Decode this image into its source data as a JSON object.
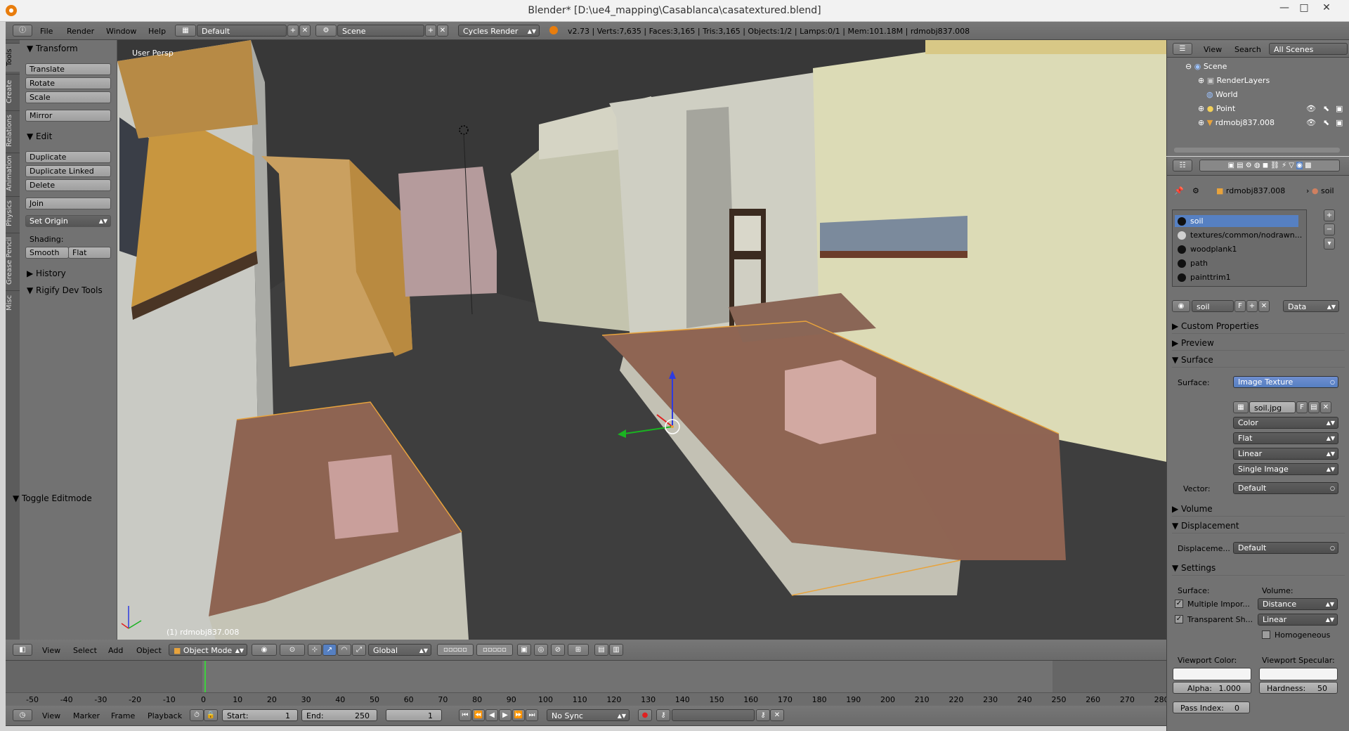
{
  "window": {
    "title": "Blender* [D:\\ue4_mapping\\Casablanca\\casatextured.blend]",
    "minimize": "—",
    "maximize": "□",
    "close": "✕"
  },
  "topbar": {
    "menus": [
      "File",
      "Render",
      "Window",
      "Help"
    ],
    "layout": "Default",
    "scene": "Scene",
    "engine": "Cycles Render",
    "stats": "v2.73 | Verts:7,635 | Faces:3,165 | Tris:3,165 | Objects:1/2 | Lamps:0/1 | Mem:101.18M | rdmobj837.008"
  },
  "toolshelf": {
    "tabs": [
      "Tools",
      "Create",
      "Relations",
      "Animation",
      "Physics",
      "Grease Pencil",
      "Misc"
    ],
    "transform": {
      "header": "Transform",
      "translate": "Translate",
      "rotate": "Rotate",
      "scale": "Scale",
      "mirror": "Mirror"
    },
    "edit": {
      "header": "Edit",
      "duplicate": "Duplicate",
      "duplicate_linked": "Duplicate Linked",
      "delete": "Delete",
      "join": "Join",
      "set_origin": "Set Origin"
    },
    "shading": {
      "label": "Shading:",
      "smooth": "Smooth",
      "flat": "Flat"
    },
    "history": "History",
    "rigify": "Rigify Dev Tools",
    "toggle_editmode": "Toggle Editmode"
  },
  "viewport": {
    "view_label": "User Persp",
    "object_label": "(1) rdmobj837.008"
  },
  "viewport_header": {
    "menus": [
      "View",
      "Select",
      "Add",
      "Object"
    ],
    "mode": "Object Mode",
    "orientation": "Global"
  },
  "timeline": {
    "ticks": [
      "-50",
      "-40",
      "-30",
      "-20",
      "-10",
      "0",
      "10",
      "20",
      "30",
      "40",
      "50",
      "60",
      "70",
      "80",
      "90",
      "100",
      "110",
      "120",
      "130",
      "140",
      "150",
      "160",
      "170",
      "180",
      "190",
      "200",
      "210",
      "220",
      "230",
      "240",
      "250",
      "260",
      "270",
      "280"
    ],
    "current_frame_marker": 0,
    "menus": [
      "View",
      "Marker",
      "Frame",
      "Playback"
    ],
    "start_label": "Start:",
    "start_value": "1",
    "end_label": "End:",
    "end_value": "250",
    "current": "1",
    "sync": "No Sync"
  },
  "outliner": {
    "menus": [
      "View",
      "Search"
    ],
    "filter": "All Scenes",
    "items": [
      "Scene",
      "RenderLayers",
      "World",
      "Point",
      "rdmobj837.008"
    ]
  },
  "properties": {
    "breadcrumb_object": "rdmobj837.008",
    "breadcrumb_material": "soil",
    "materials": [
      "soil",
      "textures/common/nodrawn...",
      "woodplank1",
      "path",
      "painttrim1"
    ],
    "material_name": "soil",
    "fake_user": "F",
    "link": "Data",
    "sections": {
      "custom_properties": "Custom Properties",
      "preview": "Preview",
      "surface": "Surface",
      "volume": "Volume",
      "displacement": "Displacement",
      "settings": "Settings"
    },
    "surface": {
      "label": "Surface:",
      "value": "Image Texture",
      "image": "soil.jpg",
      "image_f": "F",
      "color": "Color",
      "projection": "Flat",
      "interpolation": "Linear",
      "source": "Single Image",
      "vector_label": "Vector:",
      "vector": "Default"
    },
    "displacement": {
      "label": "Displaceme...",
      "value": "Default"
    },
    "settings": {
      "surface_label": "Surface:",
      "volume_label": "Volume:",
      "multiple_importance": "Multiple Impor...",
      "transparent_shadows": "Transparent Sh...",
      "volume_sampling": "Distance",
      "volume_interp": "Linear",
      "homogeneous": "Homogeneous",
      "viewport_color": "Viewport Color:",
      "viewport_specular": "Viewport Specular:",
      "alpha_label": "Alpha:",
      "alpha": "1.000",
      "hardness_label": "Hardness:",
      "hardness": "50",
      "pass_index_label": "Pass Index:",
      "pass_index": "0"
    }
  },
  "colors": {
    "ui_bg": "#727272",
    "viewport_bg": "#3a3a3a",
    "selection": "#5680c2",
    "outline": "#e8a33c",
    "accent_orange": "#e87d0d"
  }
}
